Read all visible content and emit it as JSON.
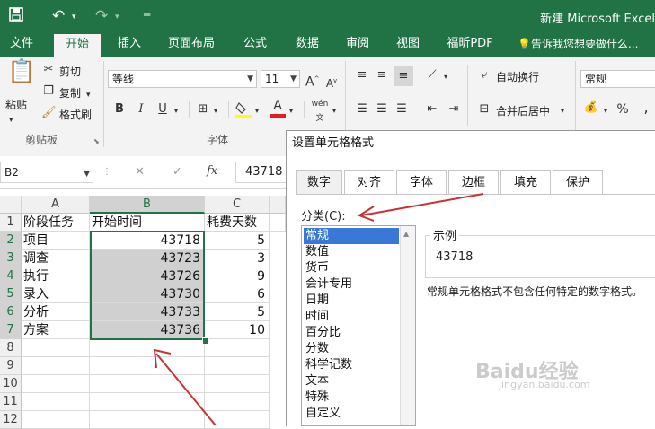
{
  "app": {
    "title": "新建 Microsoft Excel"
  },
  "quick_access": {
    "save_icon": "save-icon",
    "undo_icon": "undo-icon",
    "redo_icon": "redo-icon",
    "customize_icon": "customize-icon"
  },
  "tabs": [
    {
      "label": "文件"
    },
    {
      "label": "开始"
    },
    {
      "label": "插入"
    },
    {
      "label": "页面布局"
    },
    {
      "label": "公式"
    },
    {
      "label": "数据"
    },
    {
      "label": "审阅"
    },
    {
      "label": "视图"
    },
    {
      "label": "福昕PDF"
    }
  ],
  "tell_me": "告诉我您想要做什么...",
  "ribbon": {
    "paste": "粘贴",
    "cut": "剪切",
    "copy": "复制",
    "format_painter": "格式刷",
    "clipboard_group": "剪贴板",
    "font_name": "等线",
    "font_size": "11",
    "grow_font": "A",
    "shrink_font": "A",
    "bold": "B",
    "italic": "I",
    "underline": "U",
    "font_color_glyph": "A",
    "phonetic": "wén",
    "font_group": "字体",
    "wrap_text": "自动换行",
    "merge_center": "合并后居中",
    "number_format": "常规",
    "percent": "%"
  },
  "formula_bar": {
    "name_box": "B2",
    "fx": "fx",
    "value": "43718"
  },
  "grid": {
    "columns": [
      "A",
      "B",
      "C"
    ],
    "rows": [
      "1",
      "2",
      "3",
      "4",
      "5",
      "6",
      "7",
      "8",
      "9",
      "10",
      "11",
      "12"
    ],
    "header_row": [
      "阶段任务",
      "开始时间",
      "耗费天数"
    ],
    "data": [
      [
        "项目",
        "43718",
        "5"
      ],
      [
        "调查",
        "43723",
        "3"
      ],
      [
        "执行",
        "43726",
        "9"
      ],
      [
        "录入",
        "43730",
        "6"
      ],
      [
        "分析",
        "43733",
        "5"
      ],
      [
        "方案",
        "43736",
        "10"
      ]
    ]
  },
  "dialog": {
    "title": "设置单元格格式",
    "tabs": [
      "数字",
      "对齐",
      "字体",
      "边框",
      "填充",
      "保护"
    ],
    "category_label": "分类(C):",
    "categories": [
      "常规",
      "数值",
      "货币",
      "会计专用",
      "日期",
      "时间",
      "百分比",
      "分数",
      "科学记数",
      "文本",
      "特殊",
      "自定义"
    ],
    "selected_category": "常规",
    "sample_label": "示例",
    "sample_value": "43718",
    "description": "常规单元格格式不包含任何特定的数字格式。"
  },
  "watermark": {
    "text": "Baidu经验",
    "url": "jingyan.baidu.com"
  },
  "colors": {
    "excel_green": "#217346",
    "selection_blue": "#3a78d8",
    "arrow_red": "#c83232"
  }
}
